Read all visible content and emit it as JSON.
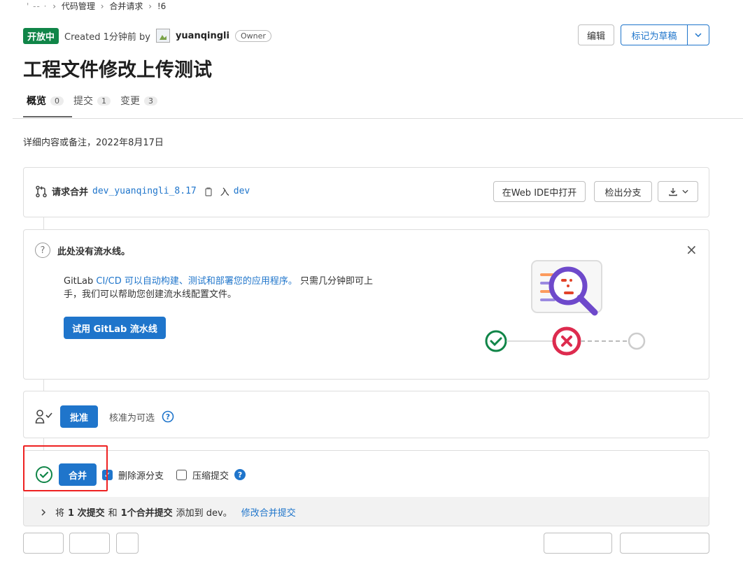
{
  "breadcrumb": {
    "items": [
      "' -- ·",
      "代码管理",
      "合并请求",
      "!6"
    ]
  },
  "header": {
    "status": "开放中",
    "created": "Created 1分钟前 by",
    "author": "yuanqingli",
    "role": "Owner",
    "edit_label": "编辑",
    "draft_label": "标记为草稿"
  },
  "title": "工程文件修改上传测试",
  "tabs": [
    {
      "label": "概览",
      "count": "0"
    },
    {
      "label": "提交",
      "count": "1"
    },
    {
      "label": "变更",
      "count": "3"
    }
  ],
  "description": "详细内容或备注，2022年8月17日",
  "merge_info": {
    "prefix": "请求合并",
    "source_branch": "dev_yuanqingli_8.17",
    "into": "入",
    "target_branch": "dev",
    "web_ide_label": "在Web IDE中打开",
    "checkout_label": "检出分支"
  },
  "pipeline": {
    "title": "此处没有流水线。",
    "text_prefix": "GitLab",
    "link_text": "CI/CD 可以自动构建、测试和部署您的应用程序。",
    "text_suffix_1": "只需几分钟即可上",
    "text_line2": "手，我们可以帮助您创建流水线配置文件。",
    "button_label": "试用 GitLab 流水线",
    "close": "×"
  },
  "approval": {
    "button_label": "批准",
    "text": "核准为可选"
  },
  "merge": {
    "button_label": "合并",
    "delete_source_label": "删除源分支",
    "delete_source_checked": true,
    "squash_label": "压缩提交",
    "squash_checked": false
  },
  "footer": {
    "text_1": "将",
    "commits": "1 次提交",
    "text_2": "和",
    "merge_commits": "1个合并提交",
    "text_3": "添加到 dev。",
    "link": "修改合并提交"
  },
  "colors": {
    "accent": "#1f75cb",
    "open_badge": "#108548",
    "success": "#108548",
    "danger": "#dd2b0e",
    "highlight": "#e22222"
  }
}
